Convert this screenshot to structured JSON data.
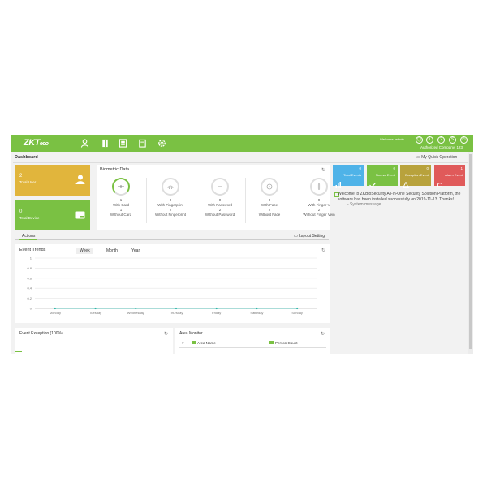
{
  "topbar": {
    "logo_main": "ZKT",
    "logo_suffix": "eco",
    "welcome": "Welcome, admin",
    "auth_company": "Authorized Company: 123",
    "nav_icons": [
      "person-icon",
      "door-icon",
      "monitor-icon",
      "clipboard-icon",
      "gear-icon"
    ],
    "right_icons": [
      "user-circle-icon",
      "info-icon",
      "help-icon",
      "skin-icon",
      "power-icon"
    ]
  },
  "header": {
    "title": "Dashboard",
    "quick_op": "My Quick Operation"
  },
  "tiles": {
    "total_user": {
      "value": "2",
      "label": "Total User"
    },
    "total_device": {
      "value": "0",
      "label": "Total Device"
    }
  },
  "biometric": {
    "title": "Biometric Data",
    "items": [
      {
        "icon": "card-icon",
        "count1": "1",
        "label1": "With Card",
        "count2": "1",
        "label2": "Without Card"
      },
      {
        "icon": "fingerprint-icon",
        "count1": "0",
        "label1": "With Fingerprint",
        "count2": "2",
        "label2": "Without Fingerprint"
      },
      {
        "icon": "password-icon",
        "count1": "0",
        "label1": "With Password",
        "count2": "2",
        "label2": "Without Password"
      },
      {
        "icon": "face-icon",
        "count1": "0",
        "label1": "With Face",
        "count2": "2",
        "label2": "Without Face"
      },
      {
        "icon": "finger-vein-icon",
        "count1": "0",
        "label1": "With Finger V",
        "count2": "2",
        "label2": "Without Finger Vein"
      }
    ]
  },
  "events": [
    {
      "value": "0",
      "label": "Total Events",
      "icon": "bar-chart-icon"
    },
    {
      "value": "0",
      "label": "Normal Event",
      "icon": "check-icon"
    },
    {
      "value": "0",
      "label": "Exception Event",
      "icon": "warning-icon"
    },
    {
      "value": "1",
      "label": "Alarm Event",
      "icon": "bell-icon"
    }
  ],
  "welcome_message": {
    "text": "Welcome to ZKBioSecurity All-in-One Security Solution Platform, the software has been installed successfully on 2019-11-13. Thanks!",
    "signature": "- System message"
  },
  "actions": {
    "tab": "Actions",
    "layout_setting": "Layout Setting"
  },
  "trends": {
    "title": "Event Trends",
    "periods": [
      "Week",
      "Month",
      "Year"
    ],
    "selected_period": "Week"
  },
  "chart_data": {
    "type": "line",
    "categories": [
      "Monday",
      "Tuesday",
      "Wednesday",
      "Thursday",
      "Friday",
      "Saturday",
      "Sunday"
    ],
    "values": [
      0,
      0,
      0,
      0,
      0,
      0,
      0
    ],
    "yticks": [
      0,
      0.2,
      0.4,
      0.6,
      0.8,
      1
    ],
    "ylim": [
      0,
      1
    ],
    "colors": {
      "line": "#2fb5a8",
      "grid": "#e6e6e6"
    }
  },
  "realtime": {
    "title": "Event Exception (100%)"
  },
  "area": {
    "title": "Area Monitor",
    "col_num": "#",
    "col_name": "Area Name",
    "col_person": "Person Count"
  },
  "colors": {
    "brand_green": "#7ac143",
    "tile_yellow": "#e1b53c",
    "event_blue": "#4fb3e8",
    "event_olive": "#b8a23c",
    "event_red": "#e05a5a"
  }
}
